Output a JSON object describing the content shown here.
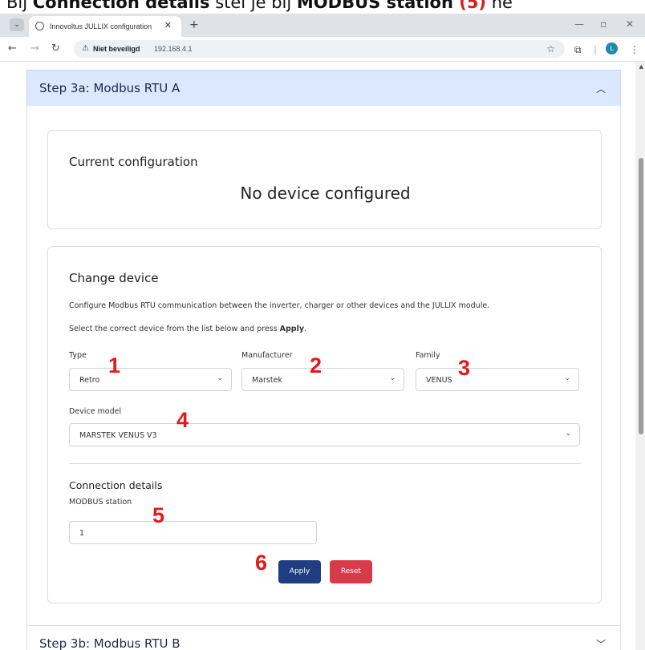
{
  "caption": {
    "prefix": "Bij ",
    "bold1": "Connection details",
    "middle": " stel je bij ",
    "bold2": "MODBUS station",
    "red": " (5)",
    "suffix": " ne"
  },
  "browser": {
    "tab_title": "Innovoltus JULLIX configuration",
    "tab_close": "✕",
    "new_tab": "+",
    "security_label": "Niet beveiligd",
    "url": "192.168.4.1",
    "profile_initial": "L"
  },
  "step_a": {
    "title": "Step 3a: Modbus RTU A",
    "chevron": "︿"
  },
  "current": {
    "title": "Current configuration",
    "status": "No device configured"
  },
  "change": {
    "title": "Change device",
    "description": "Configure Modbus RTU communication between the inverter, charger or other devices and the JULLIX module.",
    "instruction_prefix": "Select the correct device from the list below and press ",
    "instruction_bold": "Apply",
    "instruction_suffix": ".",
    "type_label": "Type",
    "type_value": "Retro",
    "manufacturer_label": "Manufacturer",
    "manufacturer_value": "Marstek",
    "family_label": "Family",
    "family_value": "VENUS",
    "model_label": "Device model",
    "model_value": "MARSTEK VENUS V3",
    "connection_title": "Connection details",
    "station_label": "MODBUS station",
    "station_value": "1",
    "apply_label": "Apply",
    "reset_label": "Reset"
  },
  "annotations": [
    "1",
    "2",
    "3",
    "4",
    "5",
    "6"
  ],
  "step_b": {
    "title": "Step 3b: Modbus RTU B",
    "chevron": "﹀"
  },
  "colors": {
    "accent_header": "#dce8ff",
    "apply": "#1f3d80",
    "reset": "#d83a4a",
    "annotation": "#e01b1b"
  }
}
